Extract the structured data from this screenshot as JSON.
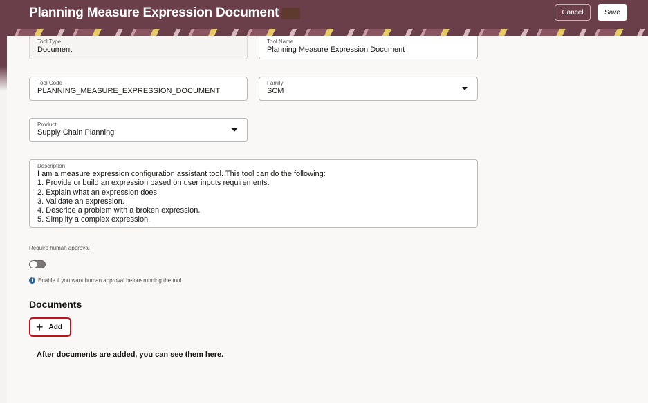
{
  "header": {
    "title": "Planning Measure Expression Document",
    "cancel_label": "Cancel",
    "save_label": "Save",
    "bg_color": "#6b3f4a"
  },
  "form": {
    "tool_type": {
      "label": "Tool Type",
      "value": "Document"
    },
    "tool_name": {
      "label": "Tool Name",
      "value": "Planning Measure Expression Document"
    },
    "tool_code": {
      "label": "Tool Code",
      "value": "PLANNING_MEASURE_EXPRESSION_DOCUMENT"
    },
    "family": {
      "label": "Family",
      "value": "SCM"
    },
    "product": {
      "label": "Product",
      "value": "Supply Chain Planning"
    },
    "description": {
      "label": "Description",
      "value": "I am a measure expression configuration assistant tool. This tool can do the following:\n1. Provide or build an expression based on user inputs requirements.\n2. Explain what an expression does.\n3. Validate an expression.\n4. Describe a problem with a broken expression.\n5. Simplify a complex expression."
    },
    "approval": {
      "label": "Require human approval",
      "enabled": false,
      "hint": "Enable if you want human approval before running the tool.",
      "info_icon": "i"
    }
  },
  "documents": {
    "heading": "Documents",
    "add_label": "Add",
    "add_icon": "+",
    "empty_text": "After documents are added, you can see them here.",
    "highlight_color": "#c0111c"
  }
}
